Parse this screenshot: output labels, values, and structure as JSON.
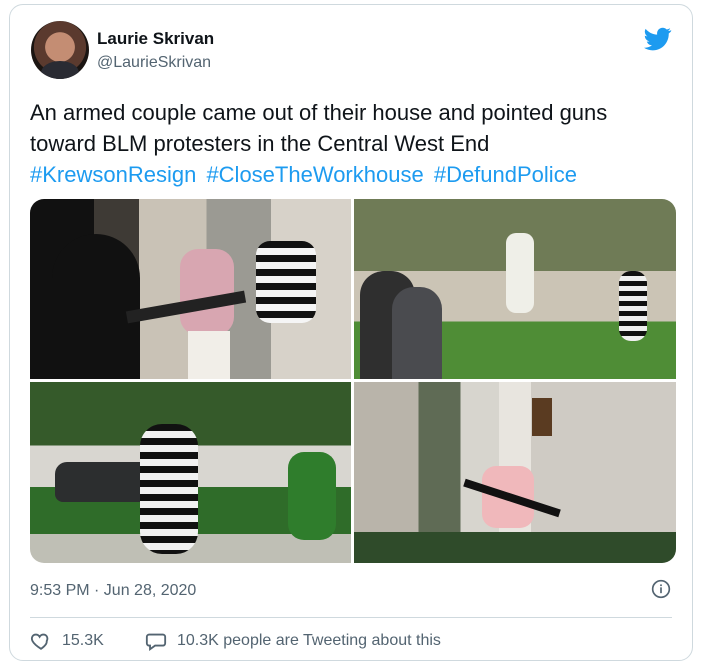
{
  "author": {
    "name": "Laurie Skrivan",
    "handle": "@LaurieSkrivan"
  },
  "tweet": {
    "line1": "An armed couple came out of their house and pointed guns",
    "line2": "toward BLM protesters in the Central West End",
    "hashtags": [
      "#KrewsonResign",
      "#CloseTheWorkhouse",
      "#DefundPolice"
    ]
  },
  "meta": {
    "timestamp": "9:53 PM · Jun 28, 2020"
  },
  "engagement": {
    "likes": "15.3K",
    "conversation": "10.3K people are Tweeting about this"
  },
  "colors": {
    "accent": "#1d9bf0",
    "text": "#0f1419",
    "secondary": "#536471",
    "border": "#cfd9de"
  },
  "icons": {
    "platform": "twitter-bird-icon",
    "info": "info-icon",
    "like": "heart-icon",
    "reply": "speech-bubble-icon"
  }
}
